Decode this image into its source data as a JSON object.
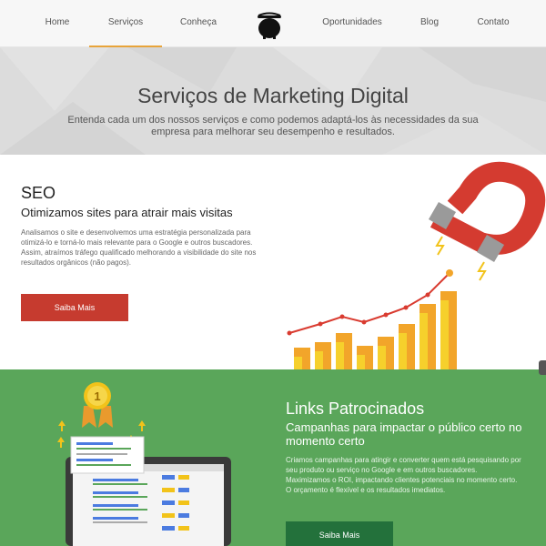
{
  "nav": {
    "items": [
      {
        "label": "Home"
      },
      {
        "label": "Serviços"
      },
      {
        "label": "Conheça"
      },
      {
        "label": "Oportunidades"
      },
      {
        "label": "Blog"
      },
      {
        "label": "Contato"
      }
    ],
    "active": "Serviços",
    "logo_icon": "cauldron-logo-icon"
  },
  "hero": {
    "title": "Serviços de Marketing Digital",
    "subtitle": "Entenda cada um dos nossos serviços e como podemos adaptá-los às necessidades da sua empresa para melhorar seu desempenho e resultados."
  },
  "seo": {
    "title": "SEO",
    "subtitle": "Otimizamos sites para atrair mais visitas",
    "body": "Analisamos o site e desenvolvemos uma estratégia personalizada para otimizá-lo e torná-lo mais relevante para o Google e outros buscadores. Assim, atraímos tráfego qualificado melhorando a visibilidade do site nos resultados orgânicos (não pagos).",
    "button": "Saiba Mais",
    "illustration_icons": [
      "magnet-icon",
      "bar-chart-icon"
    ]
  },
  "links": {
    "title": "Links Patrocinados",
    "subtitle": "Campanhas para impactar o público certo no momento certo",
    "body": "Criamos campanhas para atingir e converter quem está pesquisando por seu produto ou serviço no Google e em outros buscadores. Maximizamos o ROI, impactando clientes potenciais no momento certo. O orçamento é flexível e os resultados imediatos.",
    "button": "Saiba Mais",
    "medal_text": "1",
    "illustration_icons": [
      "medal-icon",
      "laptop-search-results-icon"
    ]
  },
  "colors": {
    "accent": "#e8a43a",
    "seo_button": "#c63b2f",
    "links_bg": "#5aa65a",
    "links_button": "#23713b"
  }
}
